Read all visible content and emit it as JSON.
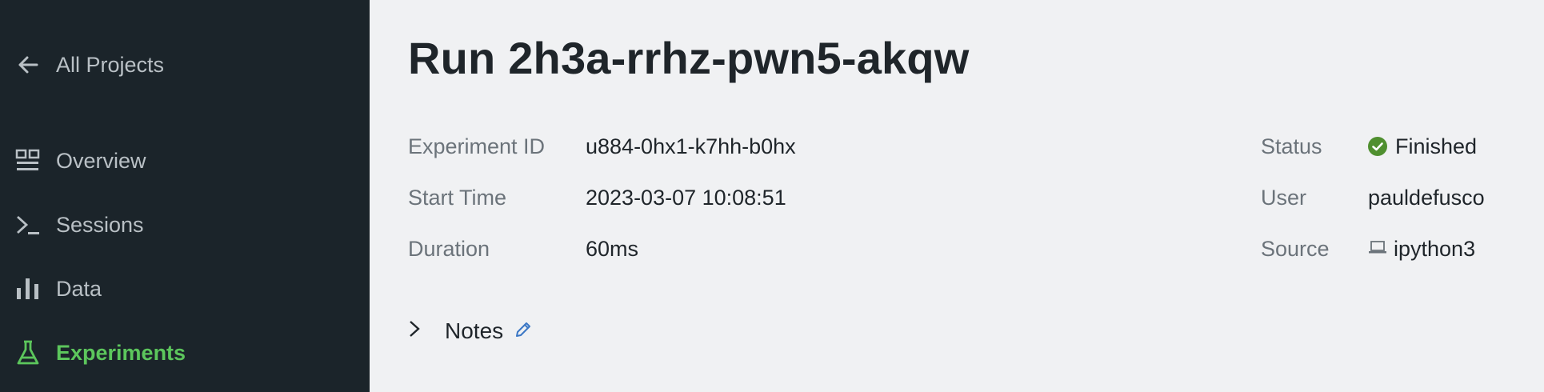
{
  "sidebar": {
    "back_label": "All Projects",
    "items": [
      {
        "label": "Overview",
        "icon": "dashboard-icon"
      },
      {
        "label": "Sessions",
        "icon": "terminal-icon"
      },
      {
        "label": "Data",
        "icon": "bar-chart-icon"
      },
      {
        "label": "Experiments",
        "icon": "flask-icon",
        "active": true
      }
    ],
    "active_color": "#5cc65c"
  },
  "run": {
    "title": "Run 2h3a-rrhz-pwn5-akqw",
    "left_fields": [
      {
        "label": "Experiment ID",
        "value": "u884-0hx1-k7hh-b0hx"
      },
      {
        "label": "Start Time",
        "value": "2023-03-07 10:08:51"
      },
      {
        "label": "Duration",
        "value": "60ms"
      }
    ],
    "right_fields": [
      {
        "label": "Status",
        "value": "Finished",
        "icon": "check-circle-icon"
      },
      {
        "label": "User",
        "value": "pauldefusco"
      },
      {
        "label": "Source",
        "value": "ipython3",
        "icon": "laptop-icon"
      }
    ],
    "notes_label": "Notes"
  }
}
